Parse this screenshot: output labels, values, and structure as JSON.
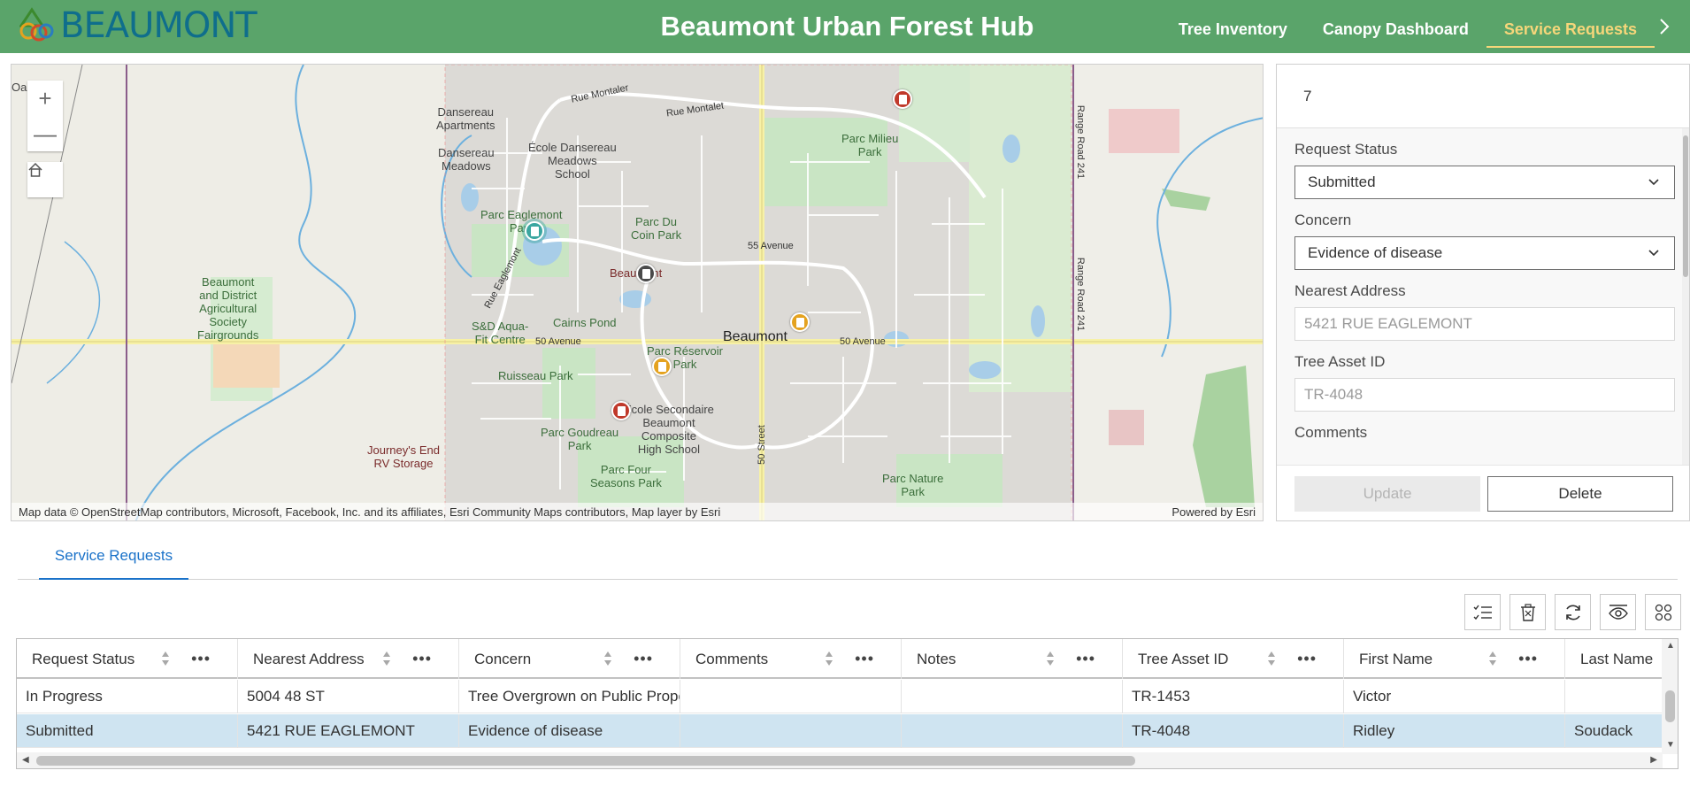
{
  "header": {
    "logo_text": "BEAUMONT",
    "title": "Beaumont Urban Forest Hub",
    "nav": [
      {
        "label": "Tree Inventory",
        "active": false
      },
      {
        "label": "Canopy Dashboard",
        "active": false
      },
      {
        "label": "Service Requests",
        "active": true
      }
    ],
    "nav_more_icon": "chevron-right-icon",
    "colors": {
      "bar": "#5aa46a",
      "active": "#f6d67a",
      "logo": "#0f6e8c"
    }
  },
  "map": {
    "controls": {
      "zoom_in": "+",
      "zoom_out": "—",
      "home_icon": "home-icon"
    },
    "labels": {
      "oak": "Oak",
      "dansereau_apts": "Dansereau\nApartments",
      "dansereau_meadows": "Dansereau\nMeadows",
      "ecole_dansereau": "École Dansereau\nMeadows\nSchool",
      "parc_eaglemont": "Parc Eaglemont\nPark",
      "parc_du_coin": "Parc Du\nCoin Park",
      "parc_milieu": "Parc Milieu\nPark",
      "fairgrounds": "Beaumont\nand District\nAgricultural\nSociety\nFairgrounds",
      "sd_aqua": "S&D Aqua-\nFit Centre",
      "cairns": "Cairns Pond",
      "beaumont": "Beaumont",
      "beaumont_small": "Beaumont",
      "reservoir": "Parc Réservoir\nPark",
      "ruisseau": "Ruisseau Park",
      "secondaire": "École Secondaire\nBeaumont\nComposite\nHigh School",
      "goudreau": "Parc Goudreau\nPark",
      "journeys": "Journey's End\nRV Storage",
      "four_seasons": "Parc Four\nSeasons Park",
      "nature": "Parc Nature\nPark",
      "rue_montaler": "Rue Montaler",
      "rue_montalet": "Rue Montalet",
      "ave55": "55 Avenue",
      "ave50a": "50 Avenue",
      "ave50b": "50 Avenue",
      "street50": "50 Street",
      "rr241a": "Range Road 241",
      "rr241b": "Range Road 241",
      "rue_eaglemont": "Rue Eaglemont"
    },
    "pins": [
      {
        "status": "Submitted",
        "color": "#c0392b"
      },
      {
        "status": "Selected",
        "color": "#3aa6a0"
      },
      {
        "status": "Closed",
        "color": "#4a4a4a"
      },
      {
        "status": "In Progress",
        "color": "#e4a21f"
      },
      {
        "status": "In Progress",
        "color": "#e4a21f"
      },
      {
        "status": "Submitted",
        "color": "#c0392b"
      }
    ],
    "attribution": "Map data © OpenStreetMap contributors, Microsoft, Facebook, Inc. and its affiliates, Esri Community Maps contributors, Map layer by Esri",
    "powered_by": "Powered by Esri"
  },
  "editor": {
    "record_id": "7",
    "fields": {
      "status_label": "Request Status",
      "status_value": "Submitted",
      "concern_label": "Concern",
      "concern_value": "Evidence of disease",
      "address_label": "Nearest Address",
      "address_value": "5421 RUE EAGLEMONT",
      "asset_label": "Tree Asset ID",
      "asset_value": "TR-4048",
      "comments_label": "Comments"
    },
    "update_label": "Update",
    "delete_label": "Delete"
  },
  "table": {
    "tab_label": "Service Requests",
    "toolbar_icons": [
      "select-list-icon",
      "delete-icon",
      "refresh-icon",
      "visibility-icon",
      "grid-icon"
    ],
    "columns": [
      "Request Status",
      "Nearest Address",
      "Concern",
      "Comments",
      "Notes",
      "Tree Asset ID",
      "First Name",
      "Last Name"
    ],
    "rows": [
      [
        "In Progress",
        "5004 48 ST",
        "Tree Overgrown on Public Property",
        "",
        "",
        "TR-1453",
        "Victor",
        ""
      ],
      [
        "Submitted",
        "5421 RUE EAGLEMONT",
        "Evidence of disease",
        "",
        "",
        "TR-4048",
        "Ridley",
        "Soudack"
      ]
    ],
    "selected_row": 1
  }
}
